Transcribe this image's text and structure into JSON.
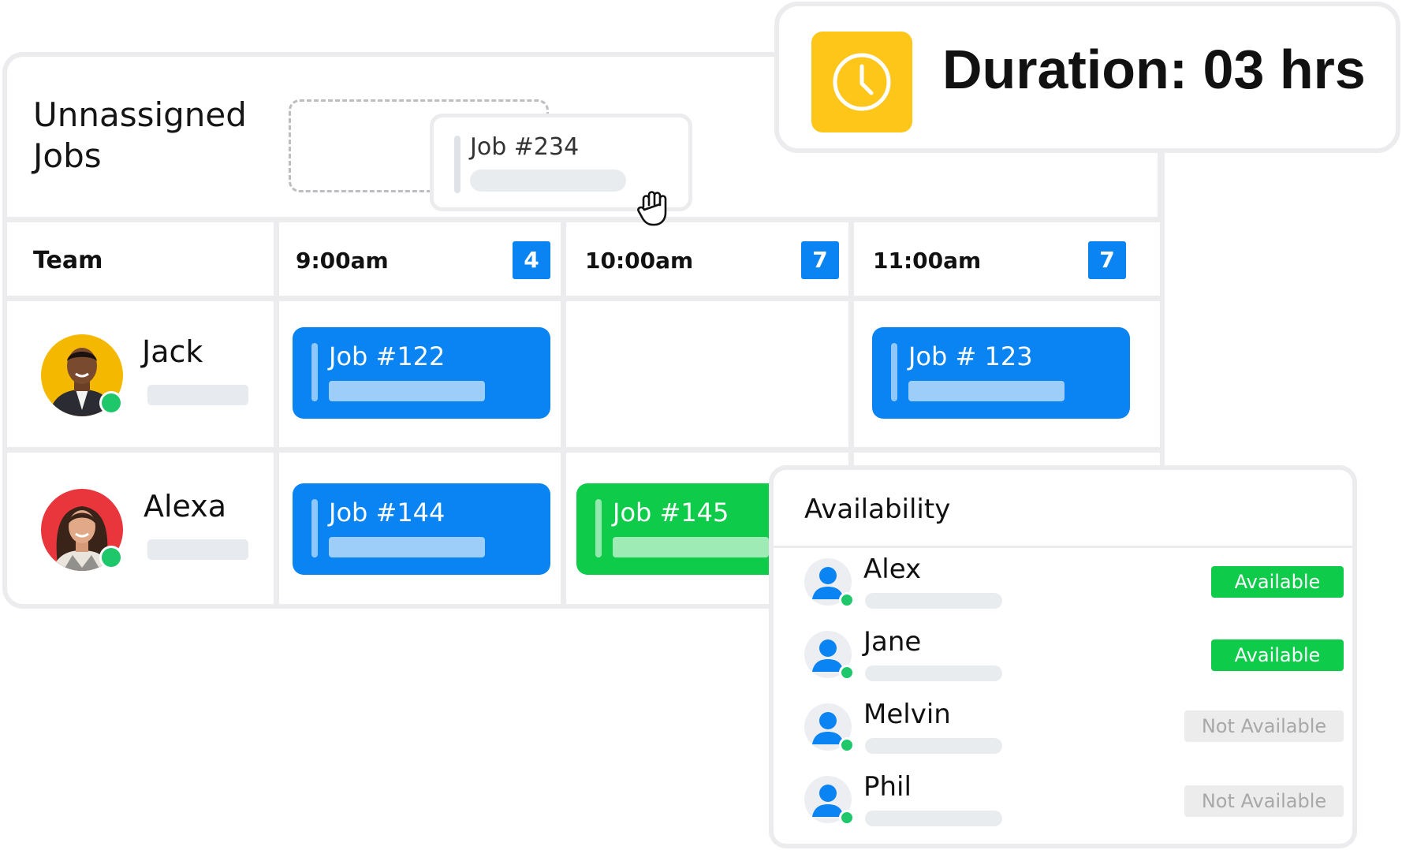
{
  "unassigned": {
    "title_line1": "Unnassigned",
    "title_line2": "Jobs",
    "dragged_job": "Job #234"
  },
  "schedule": {
    "team_header": "Team",
    "time_slots": [
      {
        "time": "9:00am",
        "count": "4"
      },
      {
        "time": "10:00am",
        "count": "7"
      },
      {
        "time": "11:00am",
        "count": "7"
      }
    ],
    "members": [
      {
        "name": "Jack",
        "jobs": [
          "Job #122",
          "Job # 123"
        ]
      },
      {
        "name": "Alexa",
        "jobs": [
          "Job #144",
          "Job #145"
        ]
      }
    ]
  },
  "duration": {
    "text": "Duration: 03 hrs"
  },
  "availability": {
    "title": "Availability",
    "people": [
      {
        "name": "Alex",
        "status": "Available"
      },
      {
        "name": "Jane",
        "status": "Available"
      },
      {
        "name": "Melvin",
        "status": "Not Available"
      },
      {
        "name": "Phil",
        "status": "Not Available"
      }
    ]
  },
  "colors": {
    "job_blue": "#0a84f3",
    "job_green": "#0ecc4a",
    "clock_yellow": "#ffc61a",
    "online_green": "#1ec86a",
    "border_gray": "#ececef"
  },
  "icons": {
    "clock": "clock-icon",
    "grab_cursor": "grab-hand-icon",
    "person": "user-icon"
  }
}
